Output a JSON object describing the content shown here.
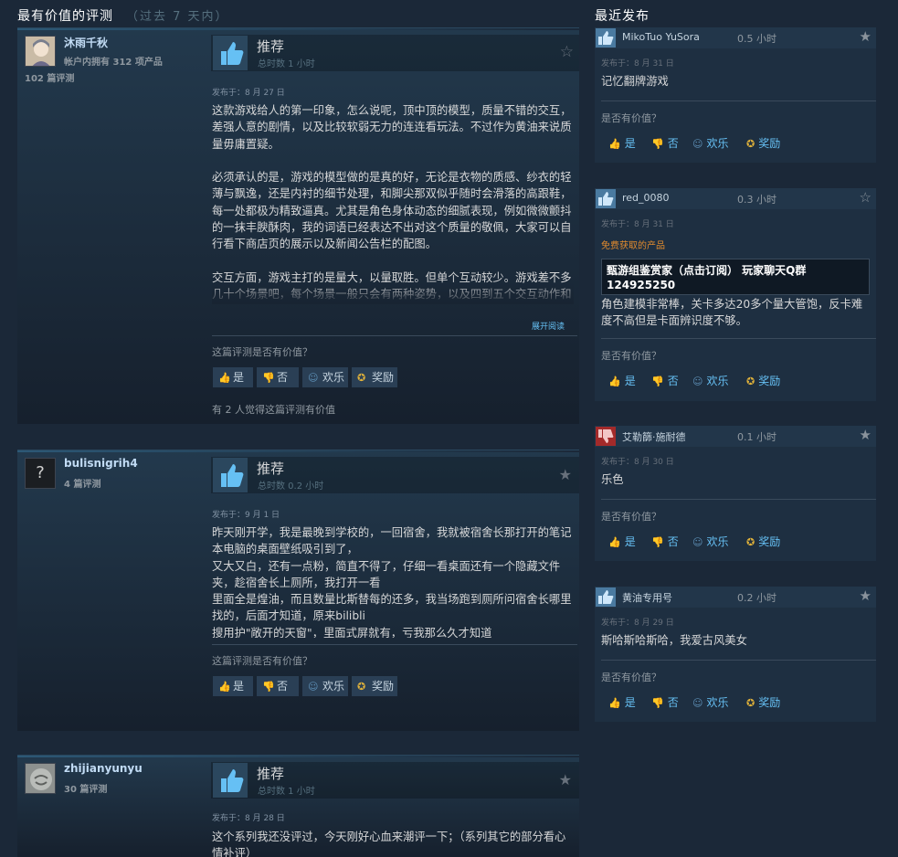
{
  "left_section": {
    "title": "最有价值的评测",
    "subtitle": "（过去 7 天内）"
  },
  "right_section": {
    "title": "最近发布"
  },
  "labels": {
    "helpful_question": "这篇评测是否有价值？",
    "yes": "是",
    "no": "否",
    "funny": "欢乐",
    "award": "奖励",
    "expand": "展开阅读",
    "short_helpful_question": "是否有价值？"
  },
  "reviews": [
    {
      "username": "沐雨千秋",
      "products_owned": "帐户内拥有 312 项产品",
      "review_count": "102 篇评测",
      "recommendation": "推荐",
      "hours": "总时数 1 小时",
      "posted": "发布于：8 月 27 日",
      "text": "这款游戏给人的第一印象，怎么说呢，顶中顶的模型，质量不错的交互，差强人意的剧情，以及比较软弱无力的连连看玩法。不过作为黄油来说质量毋庸置疑。\n\n必须承认的是，游戏的模型做的是真的好，无论是衣物的质感、纱衣的轻薄与飘逸，还是内衬的细节处理，和脚尖那双似乎随时会滑落的高跟鞋，每一处都极为精致逼真。尤其是角色身体动态的细腻表现，例如微微颤抖的一抹丰腴酥肉，我的词语已经表达不出对这个质量的敬佩，大家可以自行看下商店页的展示以及新闻公告栏的配图。\n\n交互方面，游戏主打的是量大，以量取胜。但单个互动较少。游戏差不多几十个场景吧，每个场景一般只会有两种姿势，以及四到五个交互动作和调情的语音。数量上的堆叠能让玩家根据自己的XP不断循",
      "helpful_count": "有 2 人觉得这篇评测有价值"
    },
    {
      "username": "bulisnigrih4",
      "review_count": "4 篇评测",
      "recommendation": "推荐",
      "hours": "总时数 0.2 小时",
      "posted": "发布于：9 月 1 日",
      "text": "昨天刚开学，我是最晚到学校的，一回宿舍，我就被宿舍长那打开的笔记本电脑的桌面壁纸吸引到了，\n又大又白，还有一点粉，简直不得了，仔细一看桌面还有一个隐藏文件夹，趁宿舍长上厕所，我打开一看\n里面全是煌油，而且数量比斯替每的还多，我当场跑到厕所问宿舍长哪里找的，后面才知道，原来bilibli\n搜用护\"敞开的天窗\"，里面式屏就有，亏我那么久才知道"
    },
    {
      "username": "zhijianyunyu",
      "review_count": "30 篇评测",
      "recommendation": "推荐",
      "hours": "总时数 1 小时",
      "posted": "发布于：8 月 28 日",
      "text": "这个系列我还没评过，今天刚好心血来潮评一下；（系列其它的部分看心情补评）"
    }
  ],
  "recent": [
    {
      "username": "MikoTuo YuSora",
      "hours": "0.5 小时",
      "posted": "发布于：8 月 31 日",
      "text": "记忆翻牌游戏",
      "recommended": true
    },
    {
      "username": "red_0080",
      "hours": "0.3 小时",
      "posted": "发布于：8 月 31 日",
      "free_label": "免费获取的产品",
      "curator_text": "甄游组鉴赏家（点击订阅） 玩家聊天Q群 124925250",
      "text": "角色建模非常棒，关卡多达20多个量大管饱，反卡难度不高但是卡面辨识度不够。",
      "recommended": true
    },
    {
      "username": "艾勒篩·施耐德",
      "hours": "0.1 小时",
      "posted": "发布于：8 月 30 日",
      "text": "乐色",
      "recommended": false
    },
    {
      "username": "黄油专用号",
      "hours": "0.2 小时",
      "posted": "发布于：8 月 29 日",
      "text": "斯哈斯哈斯哈，我爱古风美女",
      "recommended": true
    }
  ],
  "icons": {
    "thumbs_up": "thumbs-up-icon",
    "thumbs_down": "thumbs-down-icon",
    "star": "star-icon",
    "smiley": "smiley-icon",
    "award": "award-icon"
  },
  "colors": {
    "background": "#1b2838",
    "link": "#66c0f4",
    "username": "#c1dbf4",
    "free_product": "#e28b2e",
    "award": "#e2b33a",
    "not_recommended": "#a32a2a"
  }
}
